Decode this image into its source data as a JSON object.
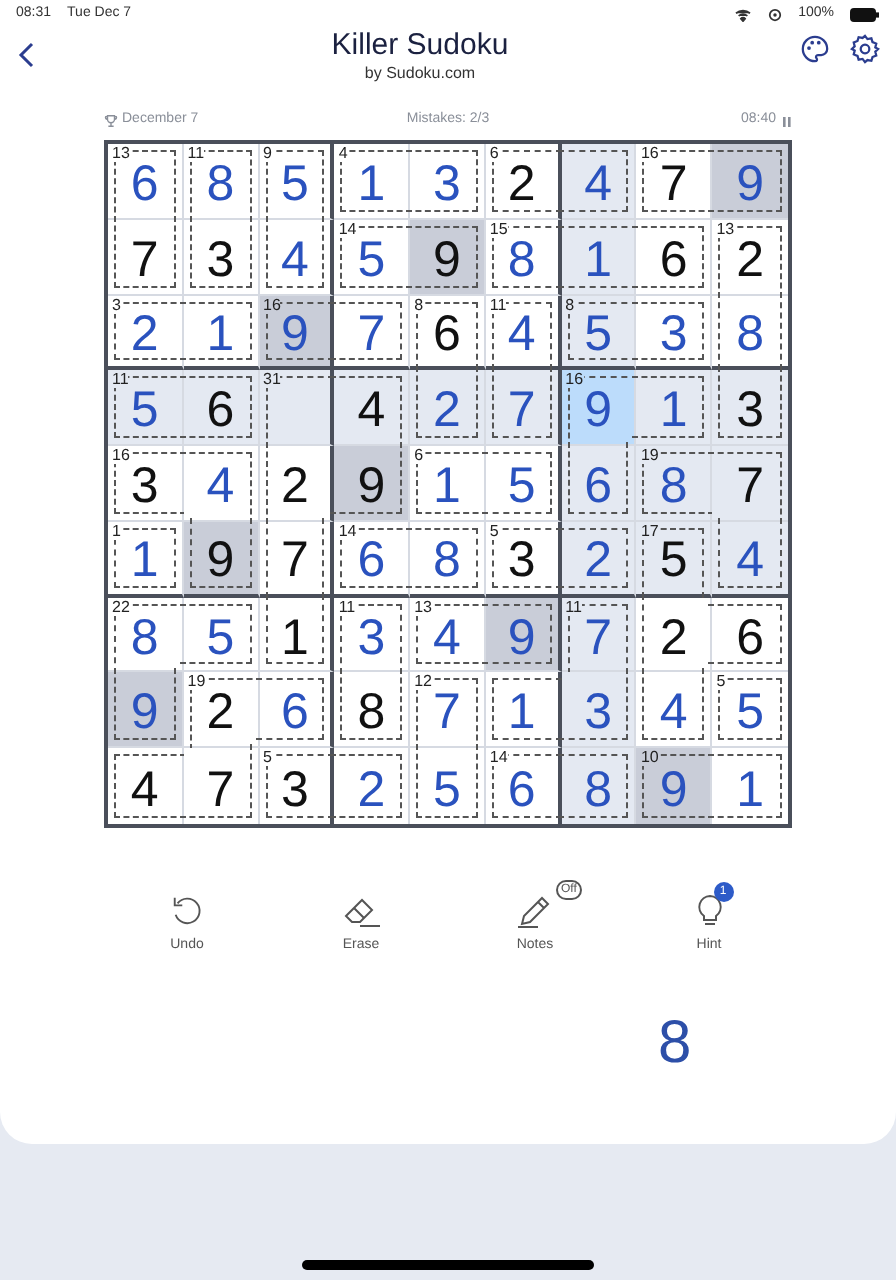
{
  "status_bar": {
    "time": "08:31",
    "date": "Tue Dec 7",
    "battery": "100%"
  },
  "header": {
    "title": "Killer Sudoku",
    "subtitle": "by Sudoku.com"
  },
  "info": {
    "challenge": "December 7",
    "mistakes": "Mistakes: 2/3",
    "timer": "08:40"
  },
  "grid": [
    [
      {
        "v": "6",
        "given": false,
        "selected": false,
        "join_right": false,
        "join_down": true,
        "sum": "13"
      },
      {
        "v": "8",
        "given": false,
        "selected": false,
        "join_right": false,
        "join_down": true,
        "sum": "11"
      },
      {
        "v": "5",
        "given": false,
        "selected": false,
        "join_right": false,
        "join_down": true,
        "sum": "9"
      },
      {
        "v": "1",
        "given": false,
        "selected": false,
        "join_right": true,
        "join_down": false,
        "sum": "4"
      },
      {
        "v": "3",
        "given": false,
        "selected": false,
        "join_right": false,
        "join_down": false
      },
      {
        "v": "2",
        "given": true,
        "selected": false,
        "join_right": true,
        "join_down": false,
        "sum": "6"
      },
      {
        "v": "4",
        "given": false,
        "selected": false,
        "join_right": false,
        "join_down": false
      },
      {
        "v": "7",
        "given": true,
        "selected": false,
        "join_right": true,
        "join_down": false,
        "sum": "16"
      },
      {
        "v": "9",
        "given": false,
        "selected": false,
        "join_right": false,
        "join_down": false
      }
    ],
    [
      {
        "v": "7",
        "given": true,
        "selected": false,
        "join_right": false,
        "join_down": false
      },
      {
        "v": "3",
        "given": true,
        "selected": false,
        "join_right": false,
        "join_down": false
      },
      {
        "v": "4",
        "given": false,
        "selected": false,
        "join_right": false,
        "join_down": false
      },
      {
        "v": "5",
        "given": false,
        "selected": false,
        "join_right": true,
        "join_down": false,
        "sum": "14"
      },
      {
        "v": "9",
        "given": true,
        "selected": false,
        "join_right": false,
        "join_down": false
      },
      {
        "v": "8",
        "given": false,
        "selected": false,
        "join_right": true,
        "join_down": false,
        "sum": "15"
      },
      {
        "v": "1",
        "given": false,
        "selected": false,
        "join_right": true,
        "join_down": false
      },
      {
        "v": "6",
        "given": true,
        "selected": false,
        "join_right": false,
        "join_down": false
      },
      {
        "v": "2",
        "given": true,
        "selected": false,
        "join_right": false,
        "join_down": true,
        "sum": "13"
      }
    ],
    [
      {
        "v": "2",
        "given": false,
        "selected": false,
        "join_right": true,
        "join_down": false,
        "sum": "3"
      },
      {
        "v": "1",
        "given": false,
        "selected": false,
        "join_right": false,
        "join_down": false
      },
      {
        "v": "9",
        "given": false,
        "selected": false,
        "join_right": true,
        "join_down": false,
        "sum": "16"
      },
      {
        "v": "7",
        "given": false,
        "selected": false,
        "join_right": false,
        "join_down": false
      },
      {
        "v": "6",
        "given": true,
        "selected": false,
        "join_right": false,
        "join_down": true,
        "sum": "8"
      },
      {
        "v": "4",
        "given": false,
        "selected": false,
        "join_right": false,
        "join_down": true,
        "sum": "11"
      },
      {
        "v": "5",
        "given": false,
        "selected": false,
        "join_right": true,
        "join_down": false,
        "sum": "8"
      },
      {
        "v": "3",
        "given": false,
        "selected": false,
        "join_right": false,
        "join_down": false
      },
      {
        "v": "8",
        "given": false,
        "selected": false,
        "join_right": false,
        "join_down": true
      }
    ],
    [
      {
        "v": "5",
        "given": false,
        "selected": false,
        "join_right": true,
        "join_down": false,
        "sum": "11"
      },
      {
        "v": "6",
        "given": true,
        "selected": false,
        "join_right": false,
        "join_down": false
      },
      {
        "selected": false,
        "join_right": true,
        "join_down": true,
        "sum": "31"
      },
      {
        "v": "4",
        "given": true,
        "selected": false,
        "join_right": false,
        "join_down": true
      },
      {
        "v": "2",
        "given": false,
        "selected": false,
        "join_right": false,
        "join_down": false
      },
      {
        "v": "7",
        "given": false,
        "selected": false,
        "join_right": false,
        "join_down": false
      },
      {
        "v": "9",
        "given": false,
        "selected": true,
        "join_right": true,
        "join_down": true,
        "sum": "16"
      },
      {
        "v": "1",
        "given": false,
        "selected": false,
        "join_right": false,
        "join_down": false
      },
      {
        "v": "3",
        "given": true,
        "selected": false,
        "join_right": false,
        "join_down": false
      }
    ],
    [
      {
        "v": "3",
        "given": true,
        "selected": false,
        "join_right": true,
        "join_down": false,
        "sum": "16"
      },
      {
        "v": "4",
        "given": false,
        "selected": false,
        "join_right": false,
        "join_down": true
      },
      {
        "v": "2",
        "given": true,
        "selected": false,
        "join_right": true,
        "join_down": true
      },
      {
        "v": "9",
        "given": true,
        "selected": false,
        "join_right": false,
        "join_down": false
      },
      {
        "v": "1",
        "given": false,
        "selected": false,
        "join_right": true,
        "join_down": false,
        "sum": "6"
      },
      {
        "v": "5",
        "given": false,
        "selected": false,
        "join_right": false,
        "join_down": false
      },
      {
        "v": "6",
        "given": false,
        "selected": false,
        "join_right": false,
        "join_down": false
      },
      {
        "v": "8",
        "given": false,
        "selected": false,
        "join_right": true,
        "join_down": false,
        "sum": "19"
      },
      {
        "v": "7",
        "given": true,
        "selected": false,
        "join_right": false,
        "join_down": true
      }
    ],
    [
      {
        "v": "1",
        "given": false,
        "selected": false,
        "join_right": false,
        "join_down": false,
        "sum": "1"
      },
      {
        "v": "9",
        "given": true,
        "selected": false,
        "join_right": false,
        "join_down": false
      },
      {
        "v": "7",
        "given": true,
        "selected": false,
        "join_right": false,
        "join_down": true
      },
      {
        "v": "6",
        "given": false,
        "selected": false,
        "join_right": true,
        "join_down": false,
        "sum": "14"
      },
      {
        "v": "8",
        "given": false,
        "selected": false,
        "join_right": false,
        "join_down": false
      },
      {
        "v": "3",
        "given": true,
        "selected": false,
        "join_right": true,
        "join_down": false,
        "sum": "5"
      },
      {
        "v": "2",
        "given": false,
        "selected": false,
        "join_right": false,
        "join_down": false
      },
      {
        "v": "5",
        "given": true,
        "selected": false,
        "join_right": false,
        "join_down": true,
        "sum": "17"
      },
      {
        "v": "4",
        "given": false,
        "selected": false,
        "join_right": false,
        "join_down": false
      }
    ],
    [
      {
        "v": "8",
        "given": false,
        "selected": false,
        "join_right": true,
        "join_down": true,
        "sum": "22"
      },
      {
        "v": "5",
        "given": false,
        "selected": false,
        "join_right": false,
        "join_down": false
      },
      {
        "v": "1",
        "given": true,
        "selected": false,
        "join_right": false,
        "join_down": false
      },
      {
        "v": "3",
        "given": false,
        "selected": false,
        "join_right": false,
        "join_down": true,
        "sum": "11"
      },
      {
        "v": "4",
        "given": false,
        "selected": false,
        "join_right": true,
        "join_down": false,
        "sum": "13"
      },
      {
        "v": "9",
        "given": false,
        "selected": false,
        "join_right": false,
        "join_down": false
      },
      {
        "v": "7",
        "given": false,
        "selected": false,
        "join_right": false,
        "join_down": true,
        "sum": "11"
      },
      {
        "v": "2",
        "given": true,
        "selected": false,
        "join_right": true,
        "join_down": true
      },
      {
        "v": "6",
        "given": true,
        "selected": false,
        "join_right": false,
        "join_down": false
      }
    ],
    [
      {
        "v": "9",
        "given": false,
        "selected": false,
        "join_right": false,
        "join_down": false
      },
      {
        "v": "2",
        "given": true,
        "selected": false,
        "join_right": true,
        "join_down": true,
        "sum": "19"
      },
      {
        "v": "6",
        "given": false,
        "selected": false,
        "join_right": false,
        "join_down": false
      },
      {
        "v": "8",
        "given": true,
        "selected": false,
        "join_right": false,
        "join_down": false
      },
      {
        "v": "7",
        "given": false,
        "selected": false,
        "join_right": false,
        "join_down": true,
        "sum": "12"
      },
      {
        "v": "1",
        "given": false,
        "selected": false,
        "join_right": true,
        "join_down": false
      },
      {
        "v": "3",
        "given": false,
        "selected": false,
        "join_right": false,
        "join_down": false
      },
      {
        "v": "4",
        "given": false,
        "selected": false,
        "join_right": false,
        "join_down": false
      },
      {
        "v": "5",
        "given": false,
        "selected": false,
        "join_right": false,
        "join_down": false,
        "sum": "5"
      }
    ],
    [
      {
        "v": "4",
        "given": true,
        "selected": false,
        "join_right": true,
        "join_down": false
      },
      {
        "v": "7",
        "given": true,
        "selected": false,
        "join_right": false,
        "join_down": false
      },
      {
        "v": "3",
        "given": true,
        "selected": false,
        "join_right": true,
        "join_down": false,
        "sum": "5"
      },
      {
        "v": "2",
        "given": false,
        "selected": false,
        "join_right": false,
        "join_down": false
      },
      {
        "v": "5",
        "given": false,
        "selected": false,
        "join_right": false,
        "join_down": false
      },
      {
        "v": "6",
        "given": false,
        "selected": false,
        "join_right": true,
        "join_down": false,
        "sum": "14"
      },
      {
        "v": "8",
        "given": false,
        "selected": false,
        "join_right": false,
        "join_down": false
      },
      {
        "v": "9",
        "given": false,
        "selected": false,
        "join_right": true,
        "join_down": false,
        "sum": "10"
      },
      {
        "v": "1",
        "given": false,
        "selected": false,
        "join_right": false,
        "join_down": false
      }
    ]
  ],
  "tools": [
    {
      "kind": "undo",
      "label": "Undo"
    },
    {
      "kind": "erase",
      "label": "Erase"
    },
    {
      "kind": "notes",
      "label": "Notes",
      "badge": "Off"
    },
    {
      "kind": "hint",
      "label": "Hint",
      "badge": "1"
    }
  ],
  "numpad": [
    {
      "digit": "8"
    }
  ]
}
